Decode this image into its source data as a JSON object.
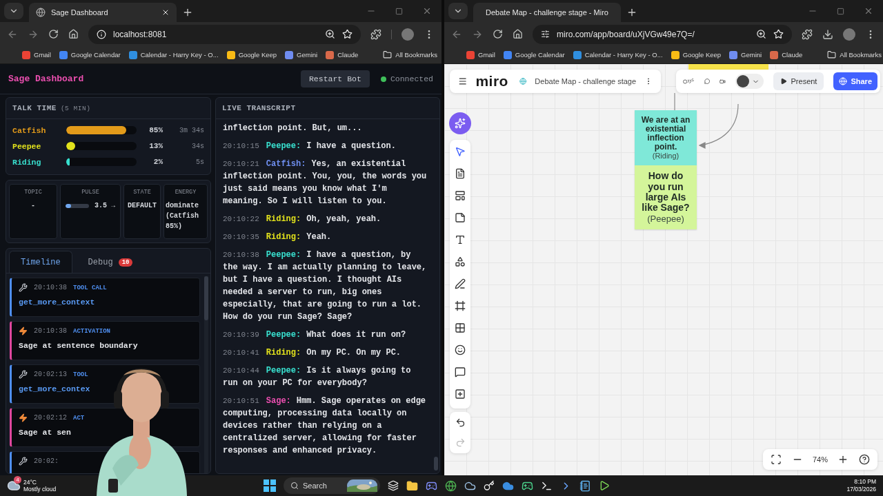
{
  "left_window": {
    "tabs": [
      {
        "title": "Sage Dashboard",
        "selected": true
      }
    ],
    "url": "localhost:8081",
    "bookmarks": [
      {
        "label": "Gmail",
        "color": "#ea4335"
      },
      {
        "label": "Google Calendar",
        "color": "#4285f4"
      },
      {
        "label": "Calendar - Harry Key - O...",
        "color": "#2f8fe0"
      },
      {
        "label": "Google Keep",
        "color": "#f9bb15"
      },
      {
        "label": "Gemini",
        "color": "#6f8cf0"
      },
      {
        "label": "Claude",
        "color": "#d9694a"
      }
    ],
    "all_bookmarks": "All Bookmarks",
    "dashboard": {
      "title": "Sage Dashboard",
      "restart": "Restart Bot",
      "status": {
        "label": "Connected",
        "on": true
      },
      "talk_time": {
        "title": "TALK TIME",
        "note": "(5 MIN)",
        "speakers": [
          {
            "name": "Catfish",
            "color": "#e39b1a",
            "level": 0.85,
            "percent": "85%",
            "duration": "3m 34s"
          },
          {
            "name": "Peepee",
            "color": "#e2e21c",
            "level": 0.13,
            "percent": "13%",
            "duration": "34s"
          },
          {
            "name": "Riding",
            "color": "#38e0cf",
            "level": 0.02,
            "percent": "2%",
            "duration": "5s"
          }
        ]
      },
      "stats": [
        {
          "kind": "text",
          "label": "TOPIC",
          "value": "-"
        },
        {
          "kind": "meter",
          "label": "PULSE",
          "value": "3.5 →",
          "level": 0.25
        },
        {
          "kind": "text",
          "label": "STATE",
          "value": "DEFAULT"
        },
        {
          "kind": "text",
          "label": "ENERGY",
          "value": "dominate (Catfish 85%)"
        }
      ],
      "tabs": [
        {
          "label": "Timeline",
          "selected": true
        },
        {
          "label": "Debug",
          "selected": false,
          "badge": "10"
        }
      ],
      "timeline": [
        {
          "kind": "tool",
          "time": "20:10:38",
          "type": "TOOL CALL",
          "text": "get_more_context"
        },
        {
          "kind": "activation",
          "time": "20:10:38",
          "type": "ACTIVATION",
          "text": "Sage at sentence boundary"
        },
        {
          "kind": "tool",
          "time": "20:02:13",
          "type": "TOOL",
          "text": "get_more_contex"
        },
        {
          "kind": "activation",
          "time": "20:02:12",
          "type": "ACT",
          "text": "Sage at sen"
        },
        {
          "kind": "tool",
          "time": "20:02:"
        }
      ],
      "transcript": {
        "title": "LIVE TRANSCRIPT",
        "entries": [
          {
            "text": "inflection point. But, um..."
          },
          {
            "time": "20:10:15",
            "speaker": "Peepee:",
            "color": "#38e0cf",
            "text": "I have a question."
          },
          {
            "time": "20:10:21",
            "speaker": "Catfish:",
            "color": "#6f8ff0",
            "text": "Yes, an existential inflection point. You, you, the words you just said means you know what I'm meaning. So I will listen to you."
          },
          {
            "time": "20:10:22",
            "speaker": "Riding:",
            "color": "#e2e21c",
            "text": "Oh, yeah, yeah."
          },
          {
            "time": "20:10:35",
            "speaker": "Riding:",
            "color": "#e2e21c",
            "text": "Yeah."
          },
          {
            "time": "20:10:38",
            "speaker": "Peepee:",
            "color": "#38e0cf",
            "text": "I have a question, by the way. I am actually planning to leave, but I have a question. I thought AIs needed a server to run, big ones especially, that are going to run a lot. How do you run Sage? Sage?"
          },
          {
            "time": "20:10:39",
            "speaker": "Peepee:",
            "color": "#38e0cf",
            "text": "What does it run on?"
          },
          {
            "time": "20:10:41",
            "speaker": "Riding:",
            "color": "#e2e21c",
            "text": "On my PC. On my PC."
          },
          {
            "time": "20:10:44",
            "speaker": "Peepee:",
            "color": "#38e0cf",
            "text": "Is it always going to run on your PC for everybody?"
          },
          {
            "time": "20:10:51",
            "speaker": "Sage:",
            "color": "#ec4fb0",
            "text": "Hmm. Sage operates on edge computing, processing data locally on devices rather than relying on a centralized server, allowing for faster responses and enhanced privacy."
          }
        ]
      }
    }
  },
  "right_window": {
    "tabs": [
      {
        "title": "Debate Map - challenge stage - Miro",
        "selected": true
      }
    ],
    "url": "miro.com/app/board/uXjVGw49e7Q=/",
    "bookmarks": [
      {
        "label": "Gmail",
        "color": "#ea4335"
      },
      {
        "label": "Google Calendar",
        "color": "#4285f4"
      },
      {
        "label": "Calendar - Harry Key - O...",
        "color": "#2f8fe0"
      },
      {
        "label": "Google Keep",
        "color": "#f9bb15"
      },
      {
        "label": "Gemini",
        "color": "#6f8cf0"
      },
      {
        "label": "Claude",
        "color": "#d9694a"
      }
    ],
    "all_bookmarks": "All Bookmarks",
    "board": {
      "logo": "miro",
      "title": "Debate Map - challenge stage",
      "present": "Present",
      "share": "Share",
      "zoom": "74%",
      "tools": [
        {
          "kind": "select",
          "selected": true
        },
        {
          "kind": "doc",
          "selected": false
        },
        {
          "kind": "template",
          "selected": false
        },
        {
          "kind": "sticky",
          "selected": false
        },
        {
          "kind": "text",
          "selected": false
        },
        {
          "kind": "shapes",
          "selected": false
        },
        {
          "kind": "pen",
          "selected": false
        },
        {
          "kind": "frame",
          "selected": false
        },
        {
          "kind": "apps",
          "selected": false
        },
        {
          "kind": "emoji",
          "selected": false
        },
        {
          "kind": "comment",
          "selected": false
        },
        {
          "kind": "more",
          "selected": false
        }
      ],
      "history": [
        {
          "kind": "undo",
          "disabled": false
        },
        {
          "kind": "redo",
          "disabled": true
        }
      ],
      "notes": [
        {
          "text": "We are at an existential inflection point.",
          "author": "(Riding)",
          "color": "#7fe8d8"
        },
        {
          "text": "How do you run large AIs like Sage?",
          "author": "(Peepee)",
          "color": "#d4f59a"
        }
      ]
    }
  },
  "taskbar": {
    "weather": {
      "badge": "4",
      "temp": "24°C",
      "text": "Mostly cloud"
    },
    "search": {
      "placeholder": "Search"
    },
    "time": "8:10 PM",
    "date": "17/03/2026"
  }
}
